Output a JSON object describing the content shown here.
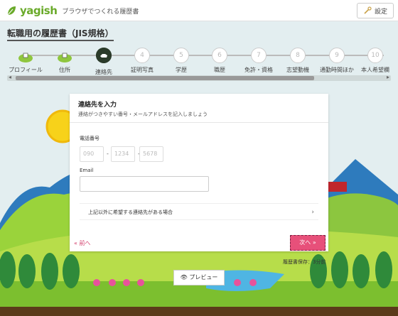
{
  "header": {
    "logo_text": "yagish",
    "tagline": "ブラウザでつくれる履歴書",
    "settings_label": "設定"
  },
  "page_title": "転職用の履歴書（JIS規格）",
  "steps": [
    {
      "num": "",
      "label": "プロフィール",
      "state": "done"
    },
    {
      "num": "",
      "label": "住所",
      "state": "done"
    },
    {
      "num": "",
      "label": "連絡先",
      "state": "active"
    },
    {
      "num": "4",
      "label": "証明写真",
      "state": "todo"
    },
    {
      "num": "5",
      "label": "学歴",
      "state": "todo"
    },
    {
      "num": "6",
      "label": "職歴",
      "state": "todo"
    },
    {
      "num": "7",
      "label": "免許・資格",
      "state": "todo"
    },
    {
      "num": "8",
      "label": "志望動機",
      "state": "todo"
    },
    {
      "num": "9",
      "label": "通勤時間ほか",
      "state": "todo"
    },
    {
      "num": "10",
      "label": "本人希望欄",
      "state": "todo"
    }
  ],
  "modal": {
    "title": "連絡先を入力",
    "subtitle": "連絡がつきやすい番号・メールアドレスを記入しましょう",
    "phone_label": "電話番号",
    "phone_placeholders": [
      "090",
      "1234",
      "5678"
    ],
    "email_label": "Email",
    "email_value": "",
    "more_contact_label": "上記以外に希望する連絡先がある場合"
  },
  "nav": {
    "back_label": "« 前へ",
    "next_label": "次へ »",
    "preview_label": "プレビュー"
  },
  "stats_text": "履歴書保存：3分前",
  "colors": {
    "accent": "#e7507a",
    "brand": "#6aaa2a"
  }
}
